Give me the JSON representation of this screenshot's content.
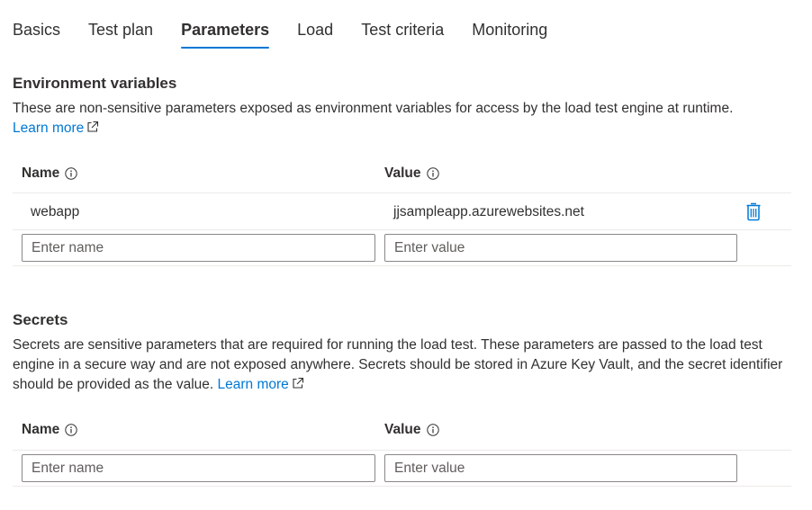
{
  "tabs": [
    {
      "label": "Basics"
    },
    {
      "label": "Test plan"
    },
    {
      "label": "Parameters",
      "active": true
    },
    {
      "label": "Load"
    },
    {
      "label": "Test criteria"
    },
    {
      "label": "Monitoring"
    }
  ],
  "env": {
    "title": "Environment variables",
    "description": "These are non-sensitive parameters exposed as environment variables for access by the load test engine at runtime.",
    "learn_more": "Learn more",
    "name_header": "Name",
    "value_header": "Value",
    "rows": [
      {
        "name": "webapp",
        "value": "jjsampleapp.azurewebsites.net"
      }
    ],
    "name_placeholder": "Enter name",
    "value_placeholder": "Enter value"
  },
  "secrets": {
    "title": "Secrets",
    "description": "Secrets are sensitive parameters that are required for running the load test. These parameters are passed to the load test engine in a secure way and are not exposed anywhere. Secrets should be stored in Azure Key Vault, and the secret identifier should be provided as the value.",
    "learn_more": "Learn more",
    "name_header": "Name",
    "value_header": "Value",
    "name_placeholder": "Enter name",
    "value_placeholder": "Enter value"
  },
  "colors": {
    "accent": "#0078d4",
    "text": "#323130",
    "border": "#8a8886",
    "divider": "#edebe9"
  },
  "icons": {
    "info": "info-icon",
    "external_link": "external-link-icon",
    "delete": "trash-icon"
  }
}
